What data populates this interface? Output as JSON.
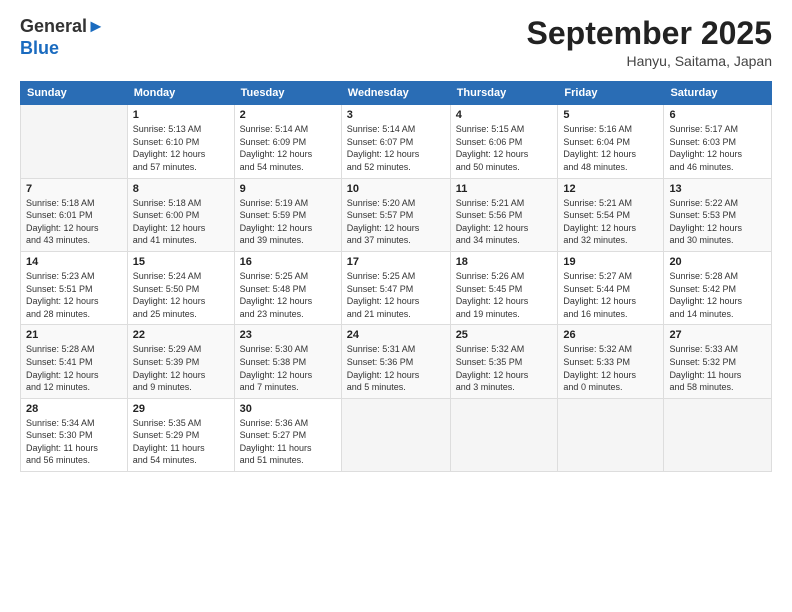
{
  "logo": {
    "general": "General",
    "blue": "Blue"
  },
  "header": {
    "title": "September 2025",
    "location": "Hanyu, Saitama, Japan"
  },
  "days_of_week": [
    "Sunday",
    "Monday",
    "Tuesday",
    "Wednesday",
    "Thursday",
    "Friday",
    "Saturday"
  ],
  "weeks": [
    [
      {
        "num": "",
        "info": ""
      },
      {
        "num": "1",
        "info": "Sunrise: 5:13 AM\nSunset: 6:10 PM\nDaylight: 12 hours\nand 57 minutes."
      },
      {
        "num": "2",
        "info": "Sunrise: 5:14 AM\nSunset: 6:09 PM\nDaylight: 12 hours\nand 54 minutes."
      },
      {
        "num": "3",
        "info": "Sunrise: 5:14 AM\nSunset: 6:07 PM\nDaylight: 12 hours\nand 52 minutes."
      },
      {
        "num": "4",
        "info": "Sunrise: 5:15 AM\nSunset: 6:06 PM\nDaylight: 12 hours\nand 50 minutes."
      },
      {
        "num": "5",
        "info": "Sunrise: 5:16 AM\nSunset: 6:04 PM\nDaylight: 12 hours\nand 48 minutes."
      },
      {
        "num": "6",
        "info": "Sunrise: 5:17 AM\nSunset: 6:03 PM\nDaylight: 12 hours\nand 46 minutes."
      }
    ],
    [
      {
        "num": "7",
        "info": "Sunrise: 5:18 AM\nSunset: 6:01 PM\nDaylight: 12 hours\nand 43 minutes."
      },
      {
        "num": "8",
        "info": "Sunrise: 5:18 AM\nSunset: 6:00 PM\nDaylight: 12 hours\nand 41 minutes."
      },
      {
        "num": "9",
        "info": "Sunrise: 5:19 AM\nSunset: 5:59 PM\nDaylight: 12 hours\nand 39 minutes."
      },
      {
        "num": "10",
        "info": "Sunrise: 5:20 AM\nSunset: 5:57 PM\nDaylight: 12 hours\nand 37 minutes."
      },
      {
        "num": "11",
        "info": "Sunrise: 5:21 AM\nSunset: 5:56 PM\nDaylight: 12 hours\nand 34 minutes."
      },
      {
        "num": "12",
        "info": "Sunrise: 5:21 AM\nSunset: 5:54 PM\nDaylight: 12 hours\nand 32 minutes."
      },
      {
        "num": "13",
        "info": "Sunrise: 5:22 AM\nSunset: 5:53 PM\nDaylight: 12 hours\nand 30 minutes."
      }
    ],
    [
      {
        "num": "14",
        "info": "Sunrise: 5:23 AM\nSunset: 5:51 PM\nDaylight: 12 hours\nand 28 minutes."
      },
      {
        "num": "15",
        "info": "Sunrise: 5:24 AM\nSunset: 5:50 PM\nDaylight: 12 hours\nand 25 minutes."
      },
      {
        "num": "16",
        "info": "Sunrise: 5:25 AM\nSunset: 5:48 PM\nDaylight: 12 hours\nand 23 minutes."
      },
      {
        "num": "17",
        "info": "Sunrise: 5:25 AM\nSunset: 5:47 PM\nDaylight: 12 hours\nand 21 minutes."
      },
      {
        "num": "18",
        "info": "Sunrise: 5:26 AM\nSunset: 5:45 PM\nDaylight: 12 hours\nand 19 minutes."
      },
      {
        "num": "19",
        "info": "Sunrise: 5:27 AM\nSunset: 5:44 PM\nDaylight: 12 hours\nand 16 minutes."
      },
      {
        "num": "20",
        "info": "Sunrise: 5:28 AM\nSunset: 5:42 PM\nDaylight: 12 hours\nand 14 minutes."
      }
    ],
    [
      {
        "num": "21",
        "info": "Sunrise: 5:28 AM\nSunset: 5:41 PM\nDaylight: 12 hours\nand 12 minutes."
      },
      {
        "num": "22",
        "info": "Sunrise: 5:29 AM\nSunset: 5:39 PM\nDaylight: 12 hours\nand 9 minutes."
      },
      {
        "num": "23",
        "info": "Sunrise: 5:30 AM\nSunset: 5:38 PM\nDaylight: 12 hours\nand 7 minutes."
      },
      {
        "num": "24",
        "info": "Sunrise: 5:31 AM\nSunset: 5:36 PM\nDaylight: 12 hours\nand 5 minutes."
      },
      {
        "num": "25",
        "info": "Sunrise: 5:32 AM\nSunset: 5:35 PM\nDaylight: 12 hours\nand 3 minutes."
      },
      {
        "num": "26",
        "info": "Sunrise: 5:32 AM\nSunset: 5:33 PM\nDaylight: 12 hours\nand 0 minutes."
      },
      {
        "num": "27",
        "info": "Sunrise: 5:33 AM\nSunset: 5:32 PM\nDaylight: 11 hours\nand 58 minutes."
      }
    ],
    [
      {
        "num": "28",
        "info": "Sunrise: 5:34 AM\nSunset: 5:30 PM\nDaylight: 11 hours\nand 56 minutes."
      },
      {
        "num": "29",
        "info": "Sunrise: 5:35 AM\nSunset: 5:29 PM\nDaylight: 11 hours\nand 54 minutes."
      },
      {
        "num": "30",
        "info": "Sunrise: 5:36 AM\nSunset: 5:27 PM\nDaylight: 11 hours\nand 51 minutes."
      },
      {
        "num": "",
        "info": ""
      },
      {
        "num": "",
        "info": ""
      },
      {
        "num": "",
        "info": ""
      },
      {
        "num": "",
        "info": ""
      }
    ]
  ]
}
